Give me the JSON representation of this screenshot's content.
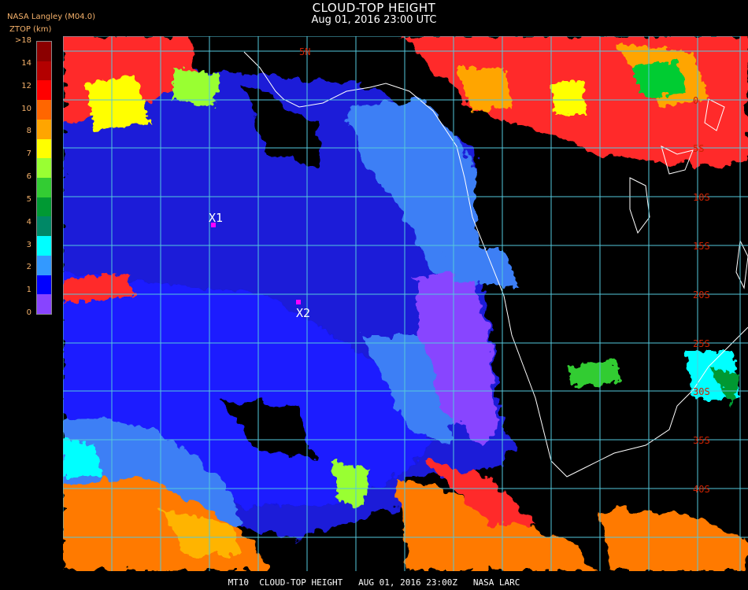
{
  "header": {
    "title": "CLOUD-TOP HEIGHT",
    "datetime": "Aug 01, 2016 23:00 UTC",
    "organization": "NASA Langley (M04.0)",
    "units": "ZTOP (km)"
  },
  "colorbar": {
    "labels": [
      ">18",
      "14",
      "12",
      "10",
      "8",
      "7",
      "6",
      "5",
      "4",
      "3",
      "2",
      "1",
      "0"
    ],
    "colors": [
      "#8b0000",
      "#b30000",
      "#ff0000",
      "#ff6600",
      "#ffa500",
      "#ffff00",
      "#99ff33",
      "#33cc33",
      "#009933",
      "#008866",
      "#00ffff",
      "#3399ff",
      "#0000ff",
      "#8844ff"
    ]
  },
  "grid": {
    "latitude_labels": [
      "5N",
      "0",
      "5S",
      "10S",
      "15S",
      "20S",
      "25S",
      "30S",
      "35S",
      "40S"
    ],
    "label_color": "#cc2200",
    "line_color": "#55c8dc"
  },
  "markers": [
    {
      "label": "X1",
      "color": "#ff00ff"
    },
    {
      "label": "X2",
      "color": "#ff00ff"
    }
  ],
  "footer": "MT10  CLOUD-TOP HEIGHT   AUG 01, 2016 23:00Z   NASA LARC"
}
